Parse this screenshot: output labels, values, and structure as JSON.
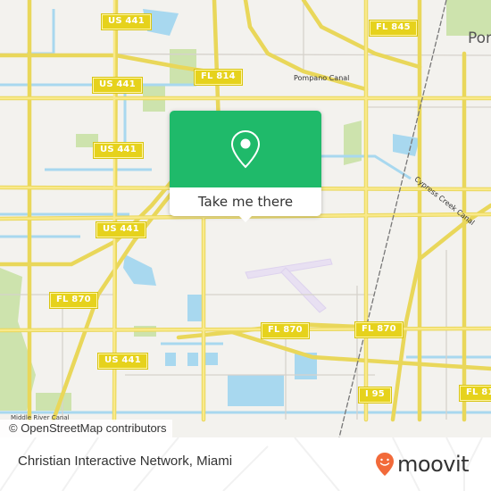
{
  "map": {
    "shields": [
      {
        "id": "us441-a",
        "label": "US 441"
      },
      {
        "id": "us441-b",
        "label": "US 441"
      },
      {
        "id": "us441-c",
        "label": "US 441"
      },
      {
        "id": "us441-d",
        "label": "US 441"
      },
      {
        "id": "us441-e",
        "label": "US 441"
      },
      {
        "id": "fl814",
        "label": "FL 814"
      },
      {
        "id": "fl845",
        "label": "FL 845"
      },
      {
        "id": "fl870-a",
        "label": "FL 870"
      },
      {
        "id": "fl870-b",
        "label": "FL 870"
      },
      {
        "id": "fl870-c",
        "label": "FL 870"
      },
      {
        "id": "i95",
        "label": "I 95"
      },
      {
        "id": "fl81x",
        "label": "FL 81"
      }
    ],
    "labels": {
      "pompano_canal": "Pompano Canal",
      "cypress_creek_canal": "Cypress Creek Canal",
      "middle_river_canal": "Middle River Canal",
      "city_partial": "Pom"
    },
    "colors": {
      "background": "#f3f2ee",
      "road": "#f7e06a",
      "water": "#a8d8ef",
      "park": "#cde3ad",
      "airport": "#e8e0f2"
    }
  },
  "popup": {
    "icon": "location-pin-icon",
    "button_label": "Take me there",
    "color": "#1fba6a"
  },
  "attribution": "© OpenStreetMap contributors",
  "footer": {
    "place_name": "Christian Interactive Network, Miami",
    "brand": "moovit",
    "brand_color": "#f26a3a"
  }
}
